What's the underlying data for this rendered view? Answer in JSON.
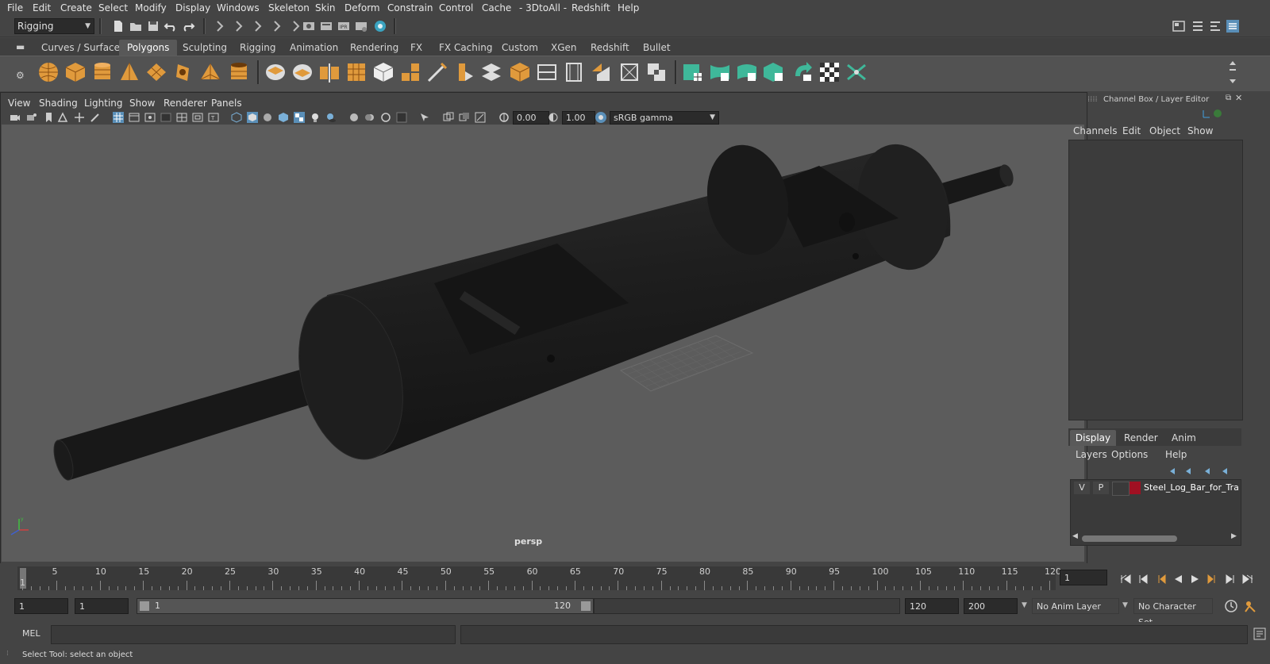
{
  "menubar": {
    "items": [
      "File",
      "Edit",
      "Create",
      "Select",
      "Modify",
      "Display",
      "Windows",
      "Skeleton",
      "Skin",
      "Deform",
      "Constrain",
      "Control",
      "Cache",
      "- 3DtoAll -",
      "Redshift",
      "Help"
    ]
  },
  "statusline": {
    "menuset": "Rigging"
  },
  "shelf": {
    "tabs": [
      "Curves / Surfaces",
      "Polygons",
      "Sculpting",
      "Rigging",
      "Animation",
      "Rendering",
      "FX",
      "FX Caching",
      "Custom",
      "XGen",
      "Redshift",
      "Bullet"
    ],
    "active_tab": "Polygons"
  },
  "viewport": {
    "menus": [
      "View",
      "Shading",
      "Lighting",
      "Show",
      "Renderer",
      "Panels"
    ],
    "exposure": "0.00",
    "gamma": "1.00",
    "colorspace": "sRGB gamma",
    "camera_label": "persp"
  },
  "channelbox": {
    "title": "Channel Box / Layer Editor",
    "menus": [
      "Channels",
      "Edit",
      "Object",
      "Show"
    ]
  },
  "layereditor": {
    "tabs": [
      "Display",
      "Render",
      "Anim"
    ],
    "active_tab": "Display",
    "menus": [
      "Layers",
      "Options",
      "Help"
    ],
    "layers": [
      {
        "v": "V",
        "p": "P",
        "color": "#a01022",
        "name": "Steel_Log_Bar_for_Training"
      }
    ]
  },
  "timeline": {
    "ticks": [
      "1",
      "5",
      "10",
      "15",
      "20",
      "25",
      "30",
      "35",
      "40",
      "45",
      "50",
      "55",
      "60",
      "65",
      "70",
      "75",
      "80",
      "85",
      "90",
      "95",
      "100",
      "105",
      "110",
      "115",
      "120"
    ],
    "current_frame": "1"
  },
  "range": {
    "start": "1",
    "playback_start": "1",
    "slider_start": "1",
    "slider_end": "120",
    "playback_end": "120",
    "end": "200",
    "anim_layer": "No Anim Layer",
    "character_set": "No Character Set"
  },
  "cmdline": {
    "label": "MEL"
  },
  "helpline": {
    "text": "Select Tool: select an object"
  }
}
